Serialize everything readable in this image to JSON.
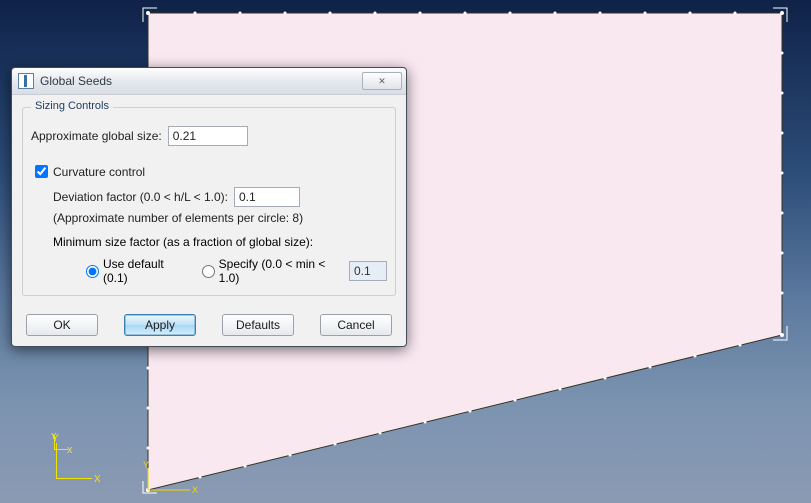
{
  "dialog": {
    "title": "Global Seeds",
    "group_legend": "Sizing Controls",
    "approx_label": "Approximate global size:",
    "approx_value": "0.21",
    "curv_checkbox_label": "Curvature control",
    "curv_checked": true,
    "deviation_label": "Deviation factor (0.0 < h/L < 1.0):",
    "deviation_value": "0.1",
    "elem_per_circle_text": "(Approximate number of elements per circle: 8)",
    "min_size_title": "Minimum size factor (as a fraction of global size):",
    "use_default_label": "Use default (0.1)",
    "specify_label": "Specify (0.0 < min < 1.0)",
    "specify_value": "0.1",
    "min_size_mode": "default",
    "buttons": {
      "ok": "OK",
      "apply": "Apply",
      "defaults": "Defaults",
      "cancel": "Cancel"
    }
  },
  "triad": {
    "x_label": "X",
    "y_label": "Y"
  }
}
